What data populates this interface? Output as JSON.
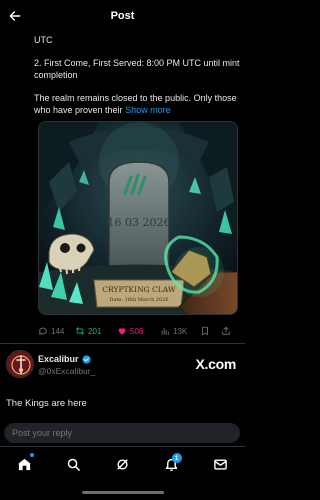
{
  "header": {
    "title": "Post",
    "back_icon": "arrow-left-icon"
  },
  "post": {
    "text_lines": [
      "UTC",
      "2. First Come, First Served: 8:00 PM UTC until mint completion",
      "The realm remains closed to the public. Only those who have proven their"
    ],
    "show_more": "Show more",
    "media": {
      "date_text": "16 03 2026",
      "plaque_title": "CRYPTKING CLAW",
      "plaque_sub": "Date: 16th March 2026"
    },
    "actions": {
      "replies": "144",
      "reposts": "201",
      "likes": "508",
      "views": "13K"
    }
  },
  "reply": {
    "name": "Excalibur",
    "handle": "@0xExcalibur_",
    "text": "The Kings are here",
    "watermark": "X.com"
  },
  "composer": {
    "placeholder": "Post your reply"
  },
  "nav": {
    "items": [
      "home-icon",
      "search-icon",
      "grok-icon",
      "notifications-icon",
      "messages-icon"
    ],
    "notification_count": "1"
  },
  "colors": {
    "accent": "#1d9bf0",
    "repost": "#00ba7c",
    "like": "#f91880",
    "muted": "#71767b",
    "background": "#000000"
  }
}
